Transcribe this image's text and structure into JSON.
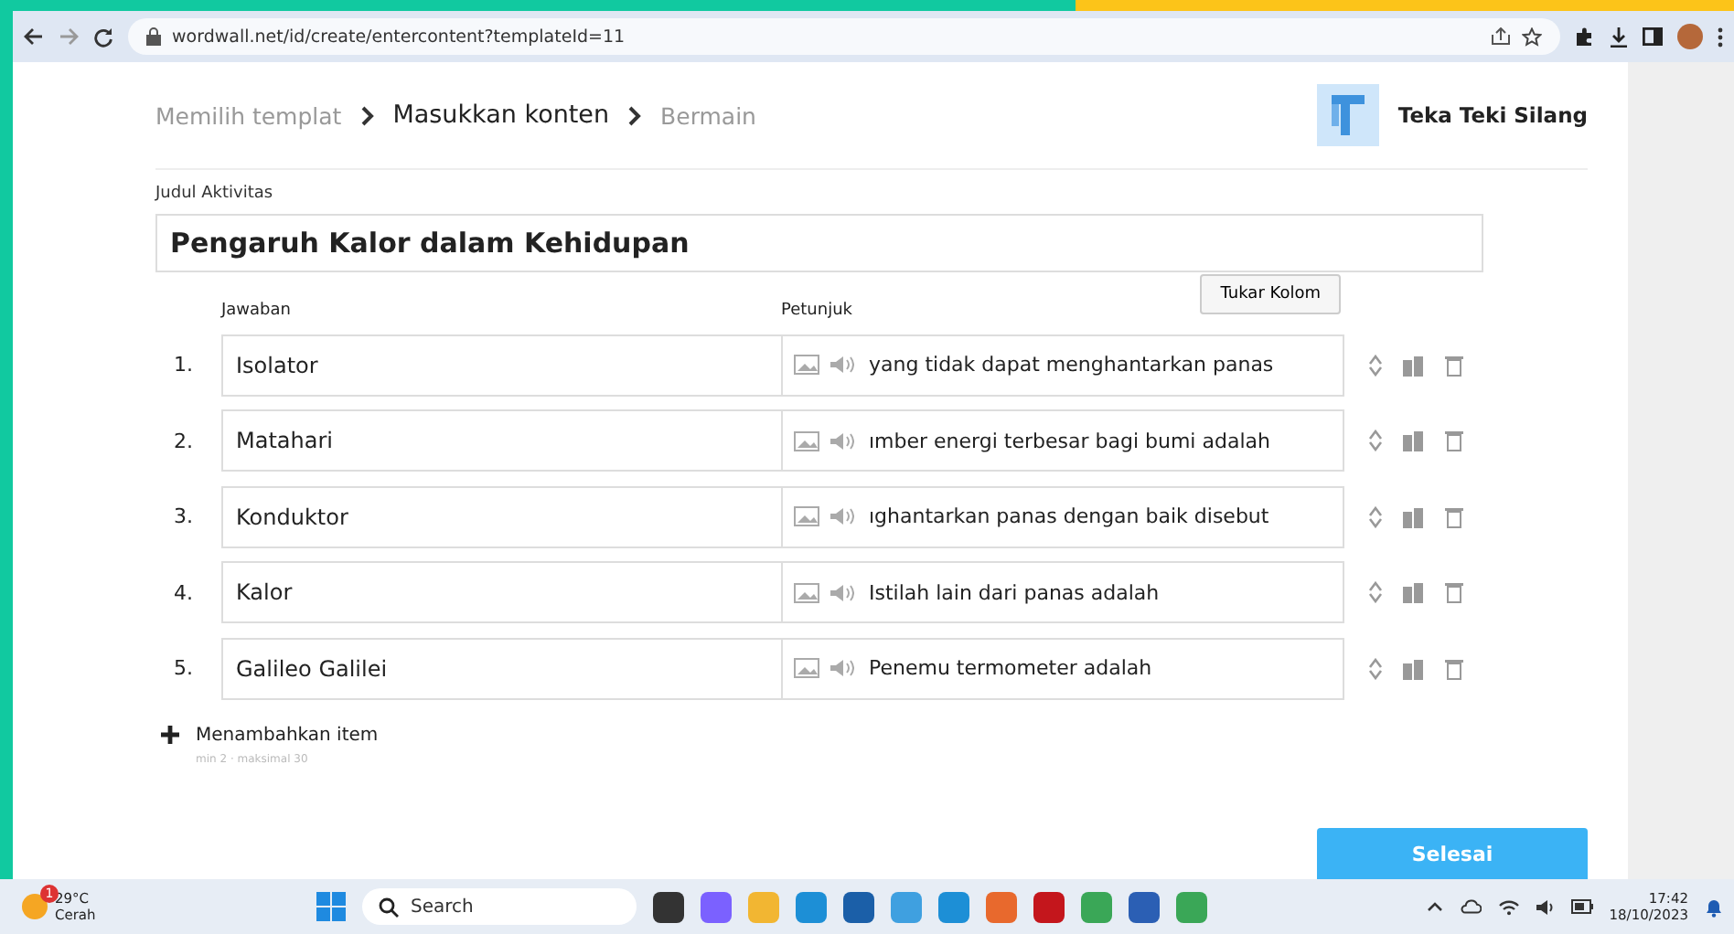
{
  "browser": {
    "url": "wordwall.net/id/create/entercontent?templateId=11"
  },
  "breadcrumb": [
    {
      "label": "Memilih templat",
      "selected": false
    },
    {
      "label": "Masukkan konten",
      "selected": true
    },
    {
      "label": "Bermain",
      "selected": false
    }
  ],
  "template": {
    "name": "Teka Teki Silang"
  },
  "activity_title": {
    "label": "Judul Aktivitas",
    "value": "Pengaruh Kalor dalam Kehidupan"
  },
  "swap_button": "Tukar Kolom",
  "columns": [
    "Jawaban",
    "Petunjuk"
  ],
  "items": [
    {
      "number": "1.",
      "answer": "Isolator",
      "clue": "yang tidak dapat menghantarkan panas"
    },
    {
      "number": "2.",
      "answer": "Matahari",
      "clue": "ımber energi terbesar bagi bumi adalah"
    },
    {
      "number": "3.",
      "answer": "Konduktor",
      "clue": "ıghantarkan panas dengan baik disebut"
    },
    {
      "number": "4.",
      "answer": "Kalor",
      "clue": "Istilah lain dari panas adalah"
    },
    {
      "number": "5.",
      "answer": "Galileo Galilei",
      "clue": "Penemu termometer adalah"
    }
  ],
  "add_item": {
    "label": "Menambahkan item",
    "hint": "min 2 · maksimal 30"
  },
  "done_button": "Selesai",
  "taskbar": {
    "weather": {
      "badge": "1",
      "temp": "29°C",
      "condition": "Cerah"
    },
    "search_placeholder": "Search",
    "time": "17:42",
    "date": "18/10/2023"
  }
}
